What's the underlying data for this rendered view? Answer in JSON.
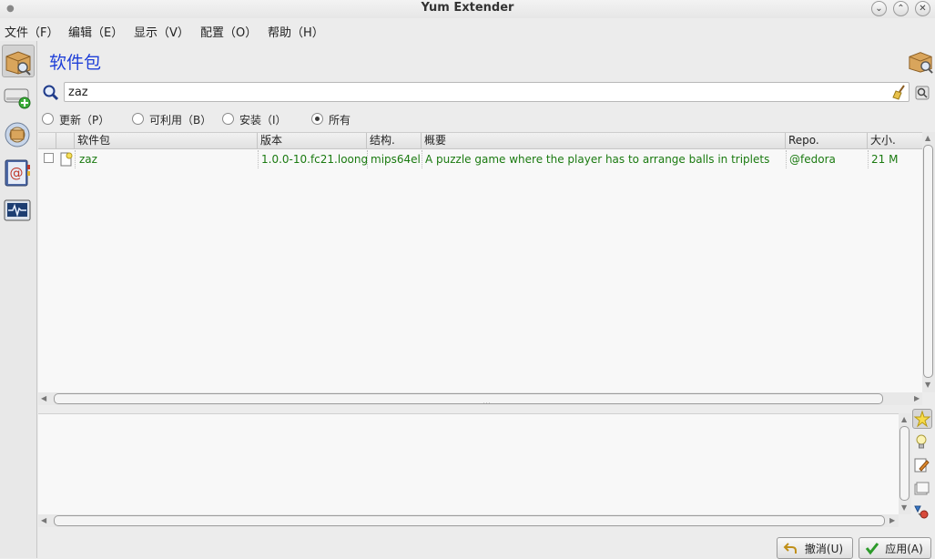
{
  "window": {
    "title": "Yum Extender"
  },
  "menu": [
    {
      "label": "文件（F）"
    },
    {
      "label": "编辑（E）"
    },
    {
      "label": "显示（V）"
    },
    {
      "label": "配置（O）"
    },
    {
      "label": "帮助（H）"
    }
  ],
  "page": {
    "title": "软件包"
  },
  "search": {
    "value": "zaz"
  },
  "filters": [
    {
      "label": "更新（P）",
      "selected": false
    },
    {
      "label": "可利用（B）",
      "selected": false
    },
    {
      "label": "安装（I）",
      "selected": false
    },
    {
      "label": "所有",
      "selected": true
    }
  ],
  "table": {
    "columns": [
      "软件包",
      "版本",
      "结构.",
      "概要",
      "Repo.",
      "大小."
    ],
    "rows": [
      {
        "checked": false,
        "name": "zaz",
        "version": "1.0.0-10.fc21.loong",
        "arch": "mips64el",
        "summary": "A puzzle game where the player has to arrange balls in triplets",
        "repo": "@fedora",
        "size": "21 M"
      }
    ]
  },
  "buttons": {
    "undo": "撤消(U)",
    "apply": "应用(A)"
  },
  "colors": {
    "title": "#1f3fd8",
    "row_text": "#1a7a10"
  }
}
